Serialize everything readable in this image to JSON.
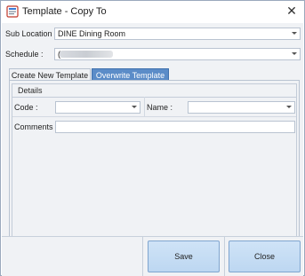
{
  "window": {
    "title": "Template - Copy To"
  },
  "form": {
    "sub_location_label": "Sub Location :",
    "sub_location_value": "DINE Dining Room",
    "schedule_label": "Schedule :",
    "schedule_value": "("
  },
  "tabs": [
    {
      "label": "Create New Template",
      "active": false
    },
    {
      "label": "Overwrite Template",
      "active": true
    }
  ],
  "details": {
    "title": "Details",
    "code_label": "Code :",
    "code_value": "",
    "name_label": "Name :",
    "name_value": "",
    "comments_label": "Comments :",
    "comments_value": ""
  },
  "buttons": {
    "save": "Save",
    "close": "Close"
  },
  "icons": {
    "app": "template-window-icon",
    "close": "close-icon",
    "dropdown": "chevron-down-icon"
  },
  "colors": {
    "active_tab": "#5b8cc8",
    "button_fill": "#c6ddf4",
    "form_background": "#f0f2f5"
  }
}
